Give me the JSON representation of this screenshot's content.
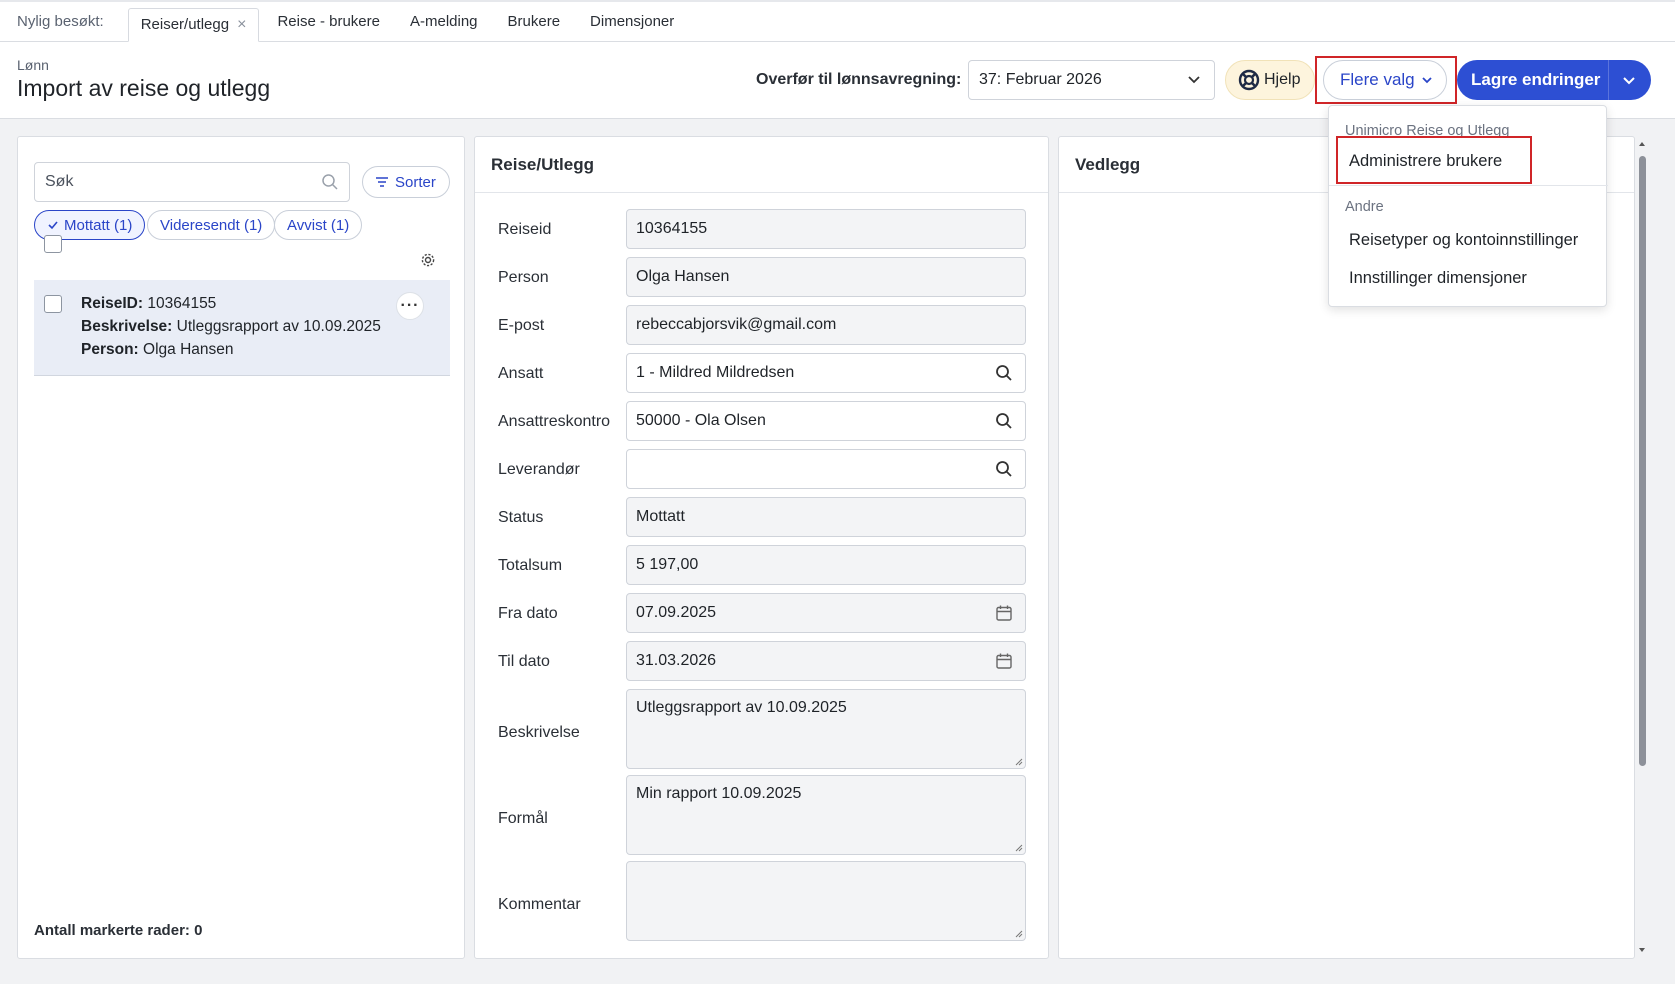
{
  "tabbar": {
    "recent_label": "Nylig besøkt:",
    "tabs": [
      {
        "label": "Reiser/utlegg",
        "active": true
      },
      {
        "label": "Reise - brukere"
      },
      {
        "label": "A-melding"
      },
      {
        "label": "Brukere"
      },
      {
        "label": "Dimensjoner"
      }
    ],
    "close_glyph": "×"
  },
  "header": {
    "breadcrumb": "Lønn",
    "title": "Import av reise og utlegg",
    "transfer_label": "Overfør til lønnsavregning:",
    "period_value": "37: Februar 2026",
    "help_label": "Hjelp",
    "more_label": "Flere valg",
    "save_label": "Lagre endringer"
  },
  "left_panel": {
    "search_placeholder": "Søk",
    "sort_label": "Sorter",
    "filters": [
      {
        "label": "Mottatt (1)",
        "active": true
      },
      {
        "label": "Videresendt (1)"
      },
      {
        "label": "Avvist (1)"
      }
    ],
    "item": {
      "id_label": "ReiseID:",
      "id_value": "10364155",
      "desc_label": "Beskrivelse:",
      "desc_value": "Utleggsrapport av 10.09.2025",
      "person_label": "Person:",
      "person_value": "Olga Hansen",
      "kebab": "···"
    },
    "footer": "Antall markerte rader: 0"
  },
  "mid_panel": {
    "title": "Reise/Utlegg",
    "fields": {
      "reiseid": {
        "label": "Reiseid",
        "value": "10364155"
      },
      "person": {
        "label": "Person",
        "value": "Olga Hansen"
      },
      "epost": {
        "label": "E-post",
        "value": "rebeccabjorsvik@gmail.com"
      },
      "ansatt": {
        "label": "Ansatt",
        "value": "1 - Mildred Mildredsen"
      },
      "ansattreskontro": {
        "label": "Ansattreskontro",
        "value": "50000 - Ola Olsen"
      },
      "leverandor": {
        "label": "Leverandør",
        "value": ""
      },
      "status": {
        "label": "Status",
        "value": "Mottatt"
      },
      "totalsum": {
        "label": "Totalsum",
        "value": "5 197,00"
      },
      "fra_dato": {
        "label": "Fra dato",
        "value": "07.09.2025"
      },
      "til_dato": {
        "label": "Til dato",
        "value": "31.03.2026"
      },
      "beskrivelse": {
        "label": "Beskrivelse",
        "value": "Utleggsrapport av 10.09.2025"
      },
      "formal": {
        "label": "Formål",
        "value": "Min rapport 10.09.2025"
      },
      "kommentar": {
        "label": "Kommentar",
        "value": ""
      }
    }
  },
  "right_panel": {
    "title": "Vedlegg"
  },
  "dropdown": {
    "group1": "Unimicro Reise og Utlegg",
    "item1": "Administrere brukere",
    "group2": "Andre",
    "item2": "Reisetyper og kontoinnstillinger",
    "item3": "Innstillinger dimensjoner"
  },
  "colors": {
    "accent": "#2d4fd3",
    "highlight": "#d02528",
    "selected_row": "#e9edf6",
    "help_bg": "#fdf4dd"
  }
}
